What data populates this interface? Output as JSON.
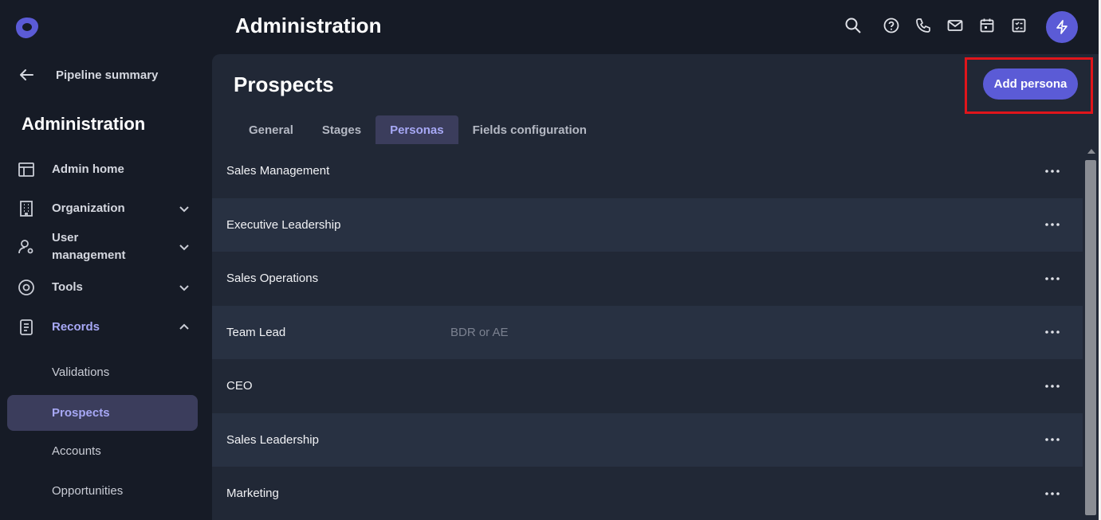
{
  "header": {
    "title": "Administration"
  },
  "sidebar": {
    "back_label": "Pipeline summary",
    "section_title": "Administration",
    "items": [
      {
        "label": "Admin home"
      },
      {
        "label": "Organization"
      },
      {
        "label": "User management"
      },
      {
        "label": "Tools"
      },
      {
        "label": "Records"
      }
    ],
    "sub_items": [
      {
        "label": "Validations"
      },
      {
        "label": "Prospects"
      },
      {
        "label": "Accounts"
      },
      {
        "label": "Opportunities"
      }
    ]
  },
  "main": {
    "title": "Prospects",
    "add_button": "Add persona",
    "tabs": [
      {
        "label": "General"
      },
      {
        "label": "Stages"
      },
      {
        "label": "Personas"
      },
      {
        "label": "Fields configuration"
      }
    ],
    "personas": [
      {
        "name": "Sales Management",
        "description": ""
      },
      {
        "name": "Executive Leadership",
        "description": ""
      },
      {
        "name": "Sales Operations",
        "description": ""
      },
      {
        "name": "Team Lead",
        "description": "BDR or AE"
      },
      {
        "name": "CEO",
        "description": ""
      },
      {
        "name": "Sales Leadership",
        "description": ""
      },
      {
        "name": "Marketing",
        "description": ""
      }
    ]
  },
  "colors": {
    "accent": "#5b5bd6",
    "active_text": "#a7a8f5",
    "highlight": "#e0151b"
  }
}
